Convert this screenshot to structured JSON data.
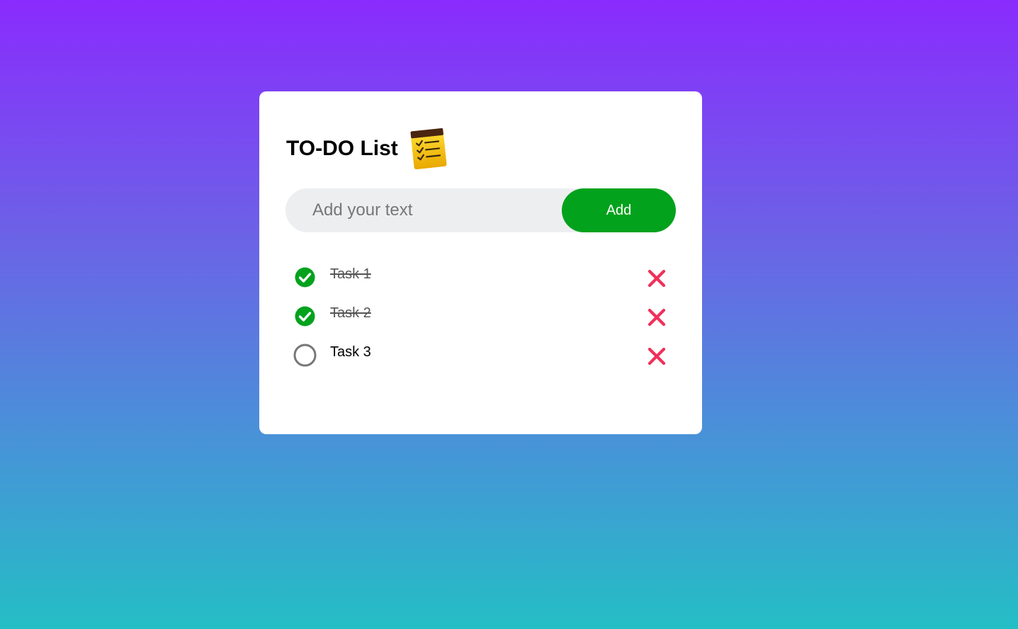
{
  "app": {
    "title": "TO-DO List",
    "title_icon": "notepad-checklist-icon"
  },
  "input": {
    "value": "",
    "placeholder": "Add your text"
  },
  "add_button": {
    "label": "Add"
  },
  "tasks": [
    {
      "text": "Task 1",
      "completed": true,
      "delete_icon": "close-icon"
    },
    {
      "text": "Task 2",
      "completed": true,
      "delete_icon": "close-icon"
    },
    {
      "text": "Task 3",
      "completed": false,
      "delete_icon": "close-icon"
    }
  ],
  "colors": {
    "accent_green": "#02a21d",
    "delete_red": "#f0305a",
    "input_background": "#edeef0",
    "gradient_top": "#8a2bfd",
    "gradient_bottom": "#24bec5"
  }
}
